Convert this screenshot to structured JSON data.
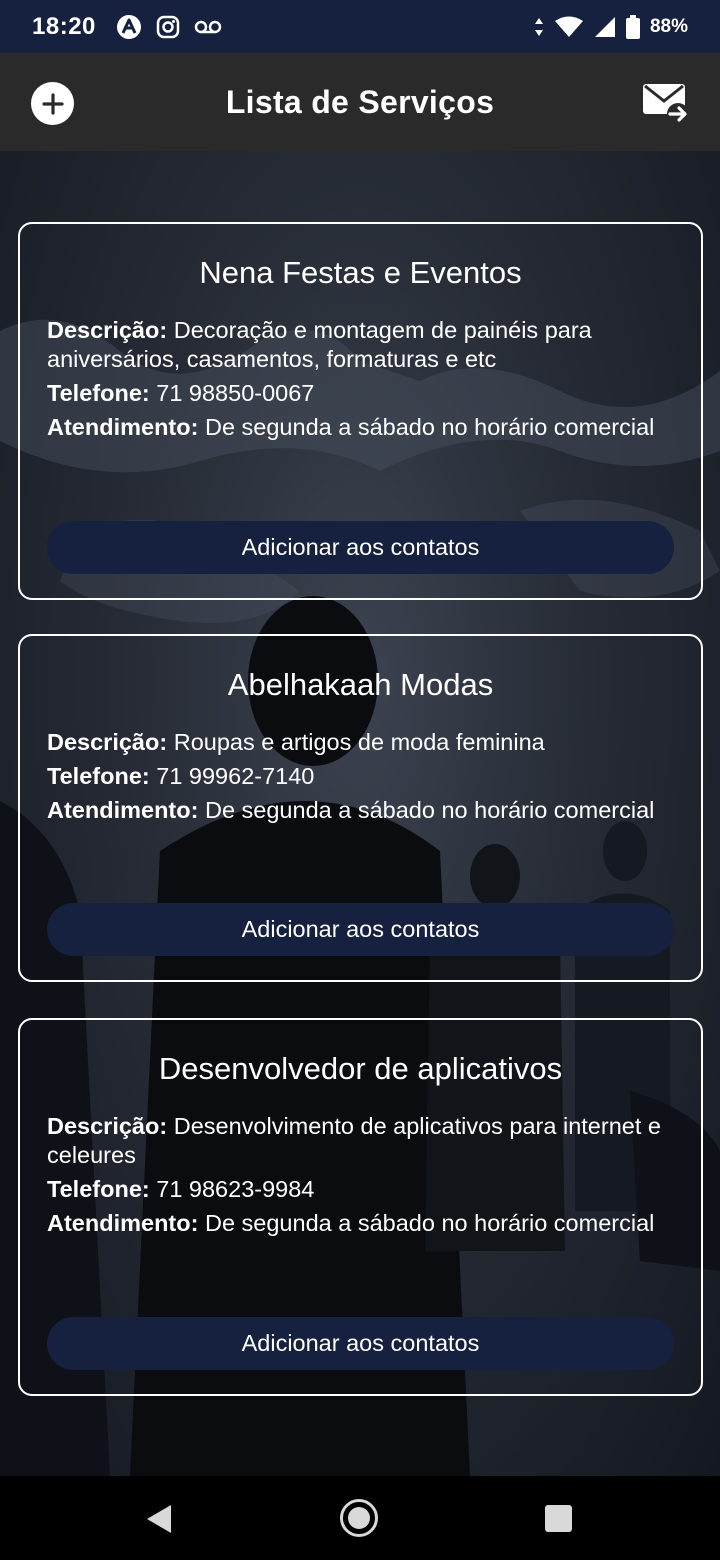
{
  "status_bar": {
    "time": "18:20",
    "battery": "88%",
    "icons": [
      "app-a-icon",
      "instagram-icon",
      "voicemail-icon",
      "data-arrows-icon",
      "wifi-icon",
      "signal-icon",
      "battery-icon"
    ]
  },
  "app_bar": {
    "title": "Lista de Serviços",
    "left_icon": "add-icon",
    "right_icon": "mail-forward-icon"
  },
  "labels": {
    "description": "Descrição:",
    "phone": "Telefone:",
    "hours": "Atendimento:"
  },
  "services": [
    {
      "name": "Nena Festas e Eventos",
      "description": "Decoração e montagem de painéis para aniversários, casamentos, formaturas e etc",
      "phone": "71 98850-0067",
      "hours": "De segunda a sábado no horário comercial",
      "button": "Adicionar aos contatos"
    },
    {
      "name": "Abelhakaah Modas",
      "description": "Roupas e artigos de moda feminina",
      "phone": "71 99962-7140",
      "hours": "De segunda a sábado no horário comercial",
      "button": "Adicionar aos contatos"
    },
    {
      "name": "Desenvolvedor de aplicativos",
      "description": "Desenvolvimento de aplicativos para internet e celeures",
      "phone": "71 98623-9984",
      "hours": "De segunda a sábado no horário comercial",
      "button": "Adicionar aos contatos"
    }
  ],
  "colors": {
    "status_bar": "#16203f",
    "app_bar": "#2a2a2b",
    "button": "#16203f",
    "card_border": "#ffffff"
  },
  "nav_bar": {
    "icons": [
      "back-icon",
      "home-icon",
      "recents-icon"
    ]
  }
}
